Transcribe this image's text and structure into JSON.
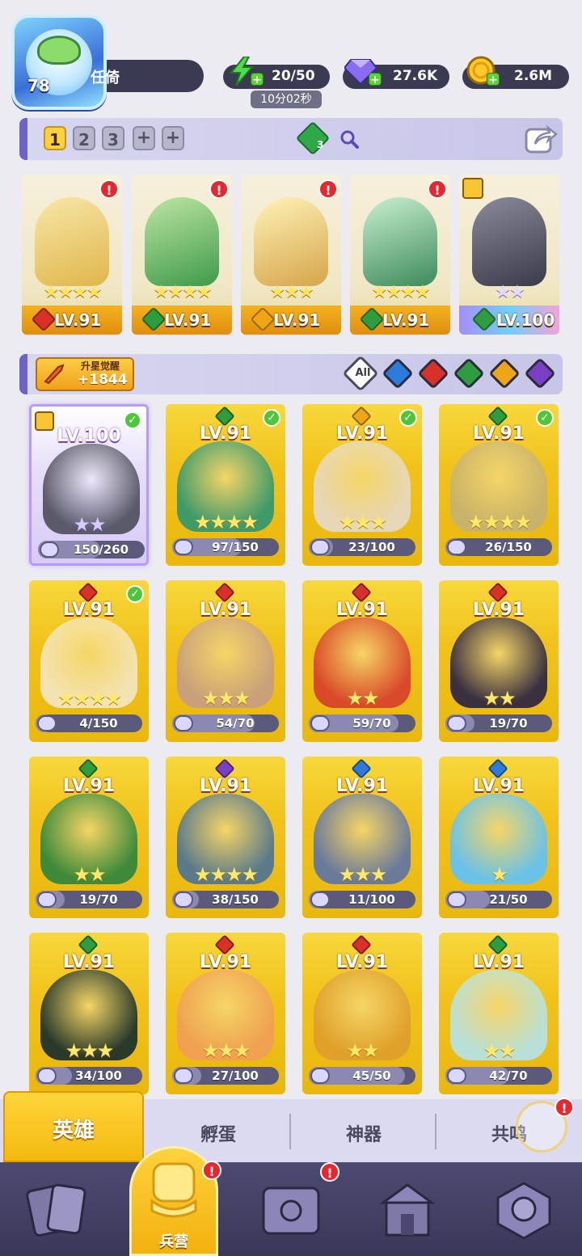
{
  "player": {
    "level": "78",
    "name": "任倚"
  },
  "resources": {
    "energy": "20/50",
    "energy_timer": "10分02秒",
    "gems": "27.6K",
    "gold": "2.6M"
  },
  "teams": {
    "tabs": [
      "1",
      "2",
      "3",
      "+",
      "+"
    ],
    "active_index": 0,
    "gem_count": "3"
  },
  "lineup": [
    {
      "level": "LV.91",
      "element": "fire",
      "stars": "★★★★",
      "alert": "!"
    },
    {
      "level": "LV.91",
      "element": "nature",
      "stars": "★★★★",
      "alert": "!"
    },
    {
      "level": "LV.91",
      "element": "light",
      "stars": "★★★",
      "alert": "!"
    },
    {
      "level": "LV.91",
      "element": "nature",
      "stars": "★★★★",
      "alert": "!"
    },
    {
      "level": "LV.100",
      "element": "nature",
      "stars": "★★",
      "rank": true
    }
  ],
  "filter": {
    "star_up_title": "升星觉醒",
    "star_up_value": "+1844",
    "all_label": "All",
    "elements": [
      "water",
      "fire",
      "nature",
      "light",
      "dark"
    ]
  },
  "element_colors": {
    "fire": "#d9302a",
    "nature": "#2e9d3f",
    "light": "#f0a515",
    "water": "#2a7bdc",
    "dark": "#7a3fc6"
  },
  "heroes": [
    {
      "level": "LV.100",
      "element": "",
      "stars": "★★",
      "shards": "150/260",
      "progress": 0.58,
      "check": true,
      "selected": true,
      "rank": true
    },
    {
      "level": "LV.91",
      "element": "nature",
      "stars": "★★★★",
      "shards": "97/150",
      "progress": 0.65,
      "check": true
    },
    {
      "level": "LV.91",
      "element": "light",
      "stars": "★★★",
      "shards": "23/100",
      "progress": 0.23,
      "check": true
    },
    {
      "level": "LV.91",
      "element": "nature",
      "stars": "★★★★",
      "shards": "26/150",
      "progress": 0.17,
      "check": true
    },
    {
      "level": "LV.91",
      "element": "fire",
      "stars": "★★★★",
      "shards": "4/150",
      "progress": 0.03,
      "check": true
    },
    {
      "level": "LV.91",
      "element": "fire",
      "stars": "★★★",
      "shards": "54/70",
      "progress": 0.77
    },
    {
      "level": "LV.91",
      "element": "fire",
      "stars": "★★",
      "shards": "59/70",
      "progress": 0.84
    },
    {
      "level": "LV.91",
      "element": "fire",
      "stars": "★★",
      "shards": "19/70",
      "progress": 0.27
    },
    {
      "level": "LV.91",
      "element": "nature",
      "stars": "★★",
      "shards": "19/70",
      "progress": 0.27
    },
    {
      "level": "LV.91",
      "element": "dark",
      "stars": "★★★★",
      "shards": "38/150",
      "progress": 0.25
    },
    {
      "level": "LV.91",
      "element": "water",
      "stars": "★★★",
      "shards": "11/100",
      "progress": 0.11
    },
    {
      "level": "LV.91",
      "element": "water",
      "stars": "★",
      "shards": "21/50",
      "progress": 0.42
    },
    {
      "level": "LV.91",
      "element": "nature",
      "stars": "★★★",
      "shards": "34/100",
      "progress": 0.34
    },
    {
      "level": "LV.91",
      "element": "fire",
      "stars": "★★★",
      "shards": "27/100",
      "progress": 0.27
    },
    {
      "level": "LV.91",
      "element": "fire",
      "stars": "★★",
      "shards": "45/50",
      "progress": 0.9
    },
    {
      "level": "LV.91",
      "element": "nature",
      "stars": "★★",
      "shards": "42/70",
      "progress": 0.6
    }
  ],
  "tabs": {
    "hero": "英雄",
    "hatch": "孵蛋",
    "artifact": "神器",
    "resonance": "共鸣"
  },
  "nav": {
    "barracks": "兵营",
    "alert": "!"
  }
}
